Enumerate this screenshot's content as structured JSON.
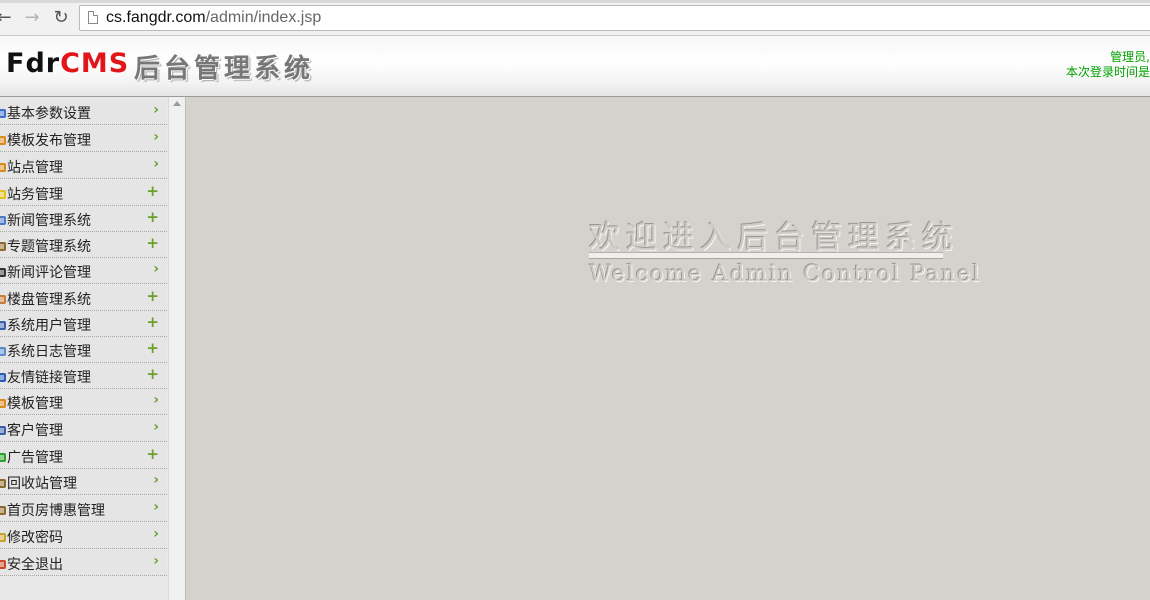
{
  "browser": {
    "back_glyph": "←",
    "forward_glyph": "→",
    "reload_glyph": "↻",
    "url_host": "cs.fangdr.com",
    "url_path": "/admin/index.jsp"
  },
  "header": {
    "logo_part1": "Fdr",
    "logo_part2": "CMS",
    "system_title": "后台管理系统",
    "admin_line1": "管理员,",
    "admin_line2": "本次登录时间是"
  },
  "sidebar": {
    "items": [
      {
        "label": "基本参数设置",
        "icon": "gear-icon",
        "indicator": "›"
      },
      {
        "label": "模板发布管理",
        "icon": "chart-icon",
        "indicator": "›"
      },
      {
        "label": "站点管理",
        "icon": "chart-icon",
        "indicator": "›"
      },
      {
        "label": "站务管理",
        "icon": "bulb-icon",
        "indicator": "+"
      },
      {
        "label": "新闻管理系统",
        "icon": "document-icon",
        "indicator": "+"
      },
      {
        "label": "专题管理系统",
        "icon": "pin-icon",
        "indicator": "+"
      },
      {
        "label": "新闻评论管理",
        "icon": "list-icon",
        "indicator": "›"
      },
      {
        "label": "楼盘管理系统",
        "icon": "building-icon",
        "indicator": "+"
      },
      {
        "label": "系统用户管理",
        "icon": "user-icon",
        "indicator": "+"
      },
      {
        "label": "系统日志管理",
        "icon": "log-icon",
        "indicator": "+"
      },
      {
        "label": "友情链接管理",
        "icon": "link-icon",
        "indicator": "+"
      },
      {
        "label": "模板管理",
        "icon": "chart-icon",
        "indicator": "›"
      },
      {
        "label": "客户管理",
        "icon": "user-icon",
        "indicator": "›"
      },
      {
        "label": "广告管理",
        "icon": "globe-icon",
        "indicator": "+"
      },
      {
        "label": "回收站管理",
        "icon": "pin-icon",
        "indicator": "›"
      },
      {
        "label": "首页房博惠管理",
        "icon": "pin-icon",
        "indicator": "›"
      },
      {
        "label": "修改密码",
        "icon": "key-icon",
        "indicator": "›"
      },
      {
        "label": "安全退出",
        "icon": "exit-icon",
        "indicator": "›"
      }
    ]
  },
  "main": {
    "welcome_cn": "欢迎进入后台管理系统",
    "welcome_en": "Welcome Admin Control Panel"
  },
  "colors": {
    "brand_red": "#e2151b",
    "admin_text": "#00a000",
    "menu_arrow": "#6aa02a",
    "main_bg": "#d5d2ce",
    "sidebar_bg": "#e5e5e5"
  }
}
